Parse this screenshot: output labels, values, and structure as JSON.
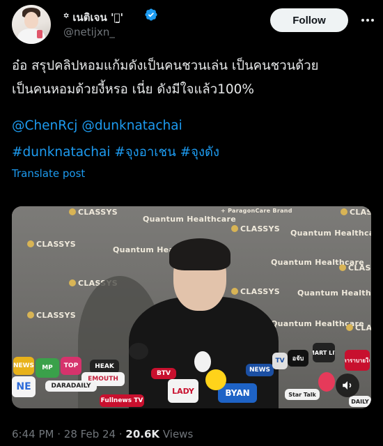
{
  "author": {
    "name": "꙳ เนติเจน 'ꪔ̤̱'",
    "handle": "@netijxn_"
  },
  "follow_label": "Follow",
  "tweet": {
    "line1": "อ๋อ สรุปคลิปหอมแก้มดังเป็นคนชวนเล่น เป็นคนชวนด้วย",
    "line2": "เป็นคนหอมด้วยงี้หรอ เนี่ย ดังมีใจแล้ว100%",
    "mentions": [
      "@ChenRcj",
      "@dunknatachai"
    ],
    "hashtags": [
      "#dunknatachai",
      "#จุงอาเชน",
      "#จุงดัง"
    ]
  },
  "translate_label": "Translate post",
  "media": {
    "backdrop_logos": [
      "CLASSYS",
      "Quantum Healthcare",
      "+ ParagonCare Brand"
    ],
    "mic_labels": [
      "NEWS",
      "MP",
      "TOP",
      "HEAK",
      "EMOUTH",
      "NE",
      "DARADAILY",
      "BTV",
      "NEWS",
      "LADY",
      "Fullnews TV",
      "BYAN",
      "TV",
      "อจับ",
      "SMART LIVE",
      "ดาราบายใจ",
      "Star Talk",
      "DAILY"
    ]
  },
  "meta": {
    "time": "6:44 PM",
    "sep": "·",
    "date": "28 Feb 24",
    "views_count": "20.6K",
    "views_label": "Views"
  },
  "colors": {
    "link": "#1d9bf0",
    "verified": "#1d9bf0",
    "background": "#000000",
    "secondary_text": "#71767b"
  }
}
